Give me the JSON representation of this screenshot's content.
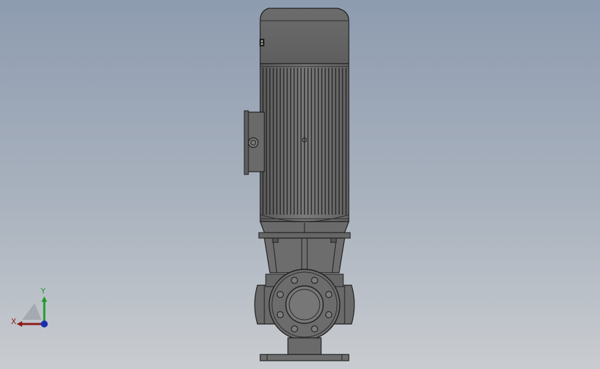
{
  "viewport": {
    "background_top": "#8e9cb0",
    "background_bottom": "#c9ccd0"
  },
  "model": {
    "part_color": "#6f6f6f",
    "edge_color": "#1e1e1e",
    "icon": "vertical-inline-pump-model"
  },
  "triad": {
    "x_label": "X",
    "y_label": "Y",
    "x_color": "#8b1a1a",
    "y_color": "#1f9a2a",
    "z_color": "#1a2fb0"
  }
}
